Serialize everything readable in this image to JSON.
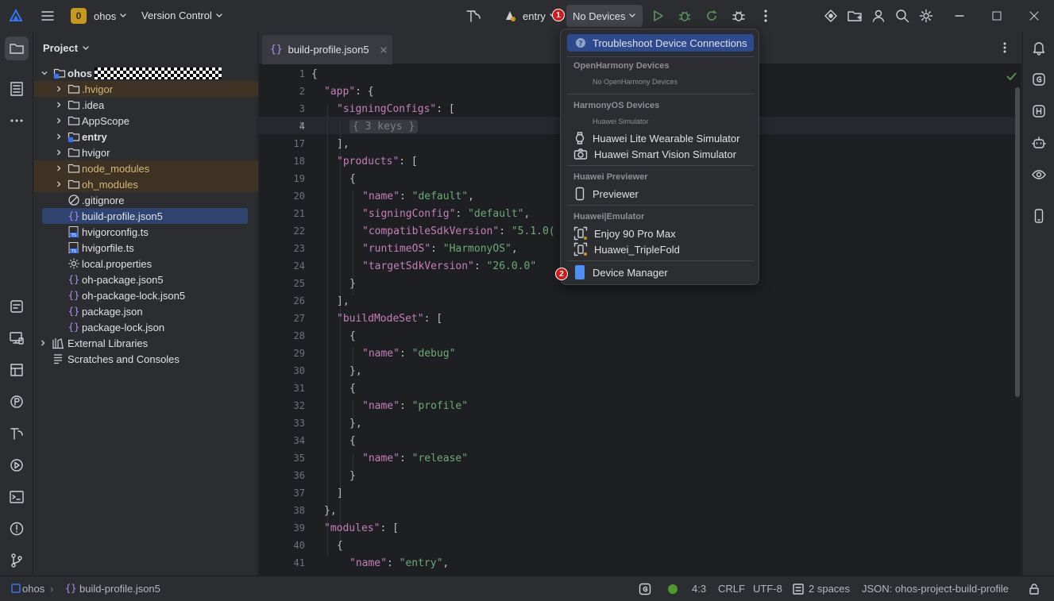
{
  "titlebar": {
    "project_badge": "0",
    "project_name": "ohos",
    "vcs_label": "Version Control",
    "run_config": "entry",
    "devices_label": "No Devices"
  },
  "annotations": {
    "badge1": "1",
    "badge2": "2"
  },
  "project_panel": {
    "title": "Project",
    "root": "ohos",
    "items": [
      {
        "label": ".hvigor",
        "kind": "folder",
        "excluded": true
      },
      {
        "label": ".idea",
        "kind": "folder"
      },
      {
        "label": "AppScope",
        "kind": "folder"
      },
      {
        "label": "entry",
        "kind": "module"
      },
      {
        "label": "hvigor",
        "kind": "folder"
      },
      {
        "label": "node_modules",
        "kind": "folder",
        "excluded": true
      },
      {
        "label": "oh_modules",
        "kind": "folder",
        "excluded": true
      },
      {
        "label": ".gitignore",
        "kind": "ignore"
      },
      {
        "label": "build-profile.json5",
        "kind": "json",
        "selected": true
      },
      {
        "label": "hvigorconfig.ts",
        "kind": "ts"
      },
      {
        "label": "hvigorfile.ts",
        "kind": "ts"
      },
      {
        "label": "local.properties",
        "kind": "props"
      },
      {
        "label": "oh-package.json5",
        "kind": "json"
      },
      {
        "label": "oh-package-lock.json5",
        "kind": "json"
      },
      {
        "label": "package.json",
        "kind": "json"
      },
      {
        "label": "package-lock.json",
        "kind": "json"
      }
    ],
    "external_libraries": "External Libraries",
    "scratches": "Scratches and Consoles"
  },
  "editor": {
    "tab_label": "build-profile.json5",
    "line_numbers": [
      "1",
      "2",
      "3",
      "4",
      "17",
      "18",
      "19",
      "20",
      "21",
      "22",
      "23",
      "24",
      "25",
      "26",
      "27",
      "28",
      "29",
      "30",
      "31",
      "32",
      "33",
      "34",
      "35",
      "36",
      "37",
      "38",
      "39",
      "40",
      "41"
    ]
  },
  "dropdown": {
    "troubleshoot": "Troubleshoot Device Connections",
    "openharmony_header": "OpenHarmony Devices",
    "no_openharmony": "No OpenHarmony Devices",
    "harmonyos_header": "HarmonyOS Devices",
    "huawei_simulator": "Huawei Simulator",
    "lite_wearable": "Huawei Lite Wearable Simulator",
    "smart_vision": "Huawei Smart Vision Simulator",
    "previewer_header": "Huawei Previewer",
    "previewer": "Previewer",
    "emulator_header": "Huawei|Emulator",
    "enjoy": "Enjoy 90 Pro Max",
    "triplefold": "Huawei_TripleFold",
    "device_manager": "Device Manager"
  },
  "statusbar": {
    "crumb_root": "ohos",
    "crumb_file": "build-profile.json5",
    "position": "4:3",
    "line_sep": "CRLF",
    "encoding": "UTF-8",
    "indent": "2 spaces",
    "schema": "JSON: ohos-project-build-profile"
  },
  "colors": {
    "accent": "#3574f0",
    "selection": "#2e436e",
    "excluded": "#3d3223"
  }
}
